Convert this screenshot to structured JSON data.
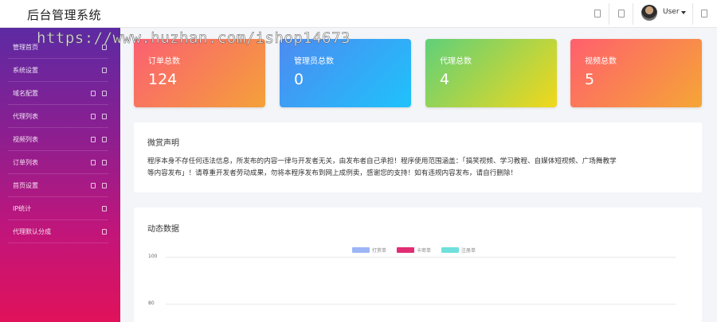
{
  "header": {
    "brand": "后台管理系统",
    "user_label": "User",
    "icons": [
      "square-icon",
      "square-icon",
      "square-icon"
    ]
  },
  "watermark": "https://www.huzhan.com/ishop14673",
  "sidebar": {
    "items": [
      {
        "label": "管理首页",
        "icons": 1
      },
      {
        "label": "系统设置",
        "icons": 1
      },
      {
        "label": "域名配置",
        "icons": 2
      },
      {
        "label": "代理列表",
        "icons": 2
      },
      {
        "label": "视频列表",
        "icons": 2
      },
      {
        "label": "订单列表",
        "icons": 2
      },
      {
        "label": "首页设置",
        "icons": 2
      },
      {
        "label": "IP统计",
        "icons": 1
      },
      {
        "label": "代理默认分成",
        "icons": 1
      }
    ],
    "colors": {
      "top": "#5d2aa3",
      "bottom": "#e0125a"
    }
  },
  "cards": [
    {
      "title": "订单总数",
      "value": "124"
    },
    {
      "title": "管理员总数",
      "value": "0"
    },
    {
      "title": "代理总数",
      "value": "4"
    },
    {
      "title": "视频总数",
      "value": "5"
    }
  ],
  "notice": {
    "title": "微赏声明",
    "line1": "程序本身不存任何违法信息，所发布的内容一律与开发者无关，由发布者自己承担！程序使用范围涵盖：「搞笑视频、学习教程、自媒体短视频、广场舞教学",
    "line2": "等内容发布」！请尊重开发者劳动成果，勿将本程序发布到网上成例卖，感谢您的支持！如有违规内容发布，请自行删除！"
  },
  "dynamic": {
    "title": "动态数据",
    "legend": [
      {
        "label": "打赏单",
        "color": "#9bb5f5"
      },
      {
        "label": "卡密单",
        "color": "#e22c73"
      },
      {
        "label": "注册单",
        "color": "#6fe0db"
      }
    ],
    "y_ticks": [
      "100",
      "80"
    ]
  }
}
